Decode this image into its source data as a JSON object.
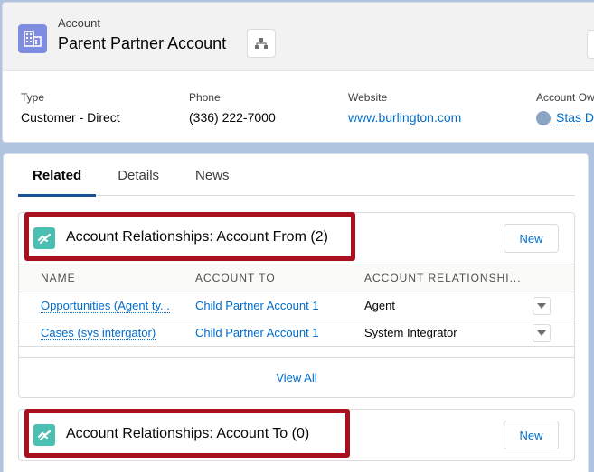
{
  "header": {
    "object_label": "Account",
    "record_title": "Parent Partner Account",
    "icons": {
      "object": "account-building-icon",
      "hierarchy": "hierarchy-icon"
    },
    "fields": [
      {
        "label": "Type",
        "value": "Customer - Direct"
      },
      {
        "label": "Phone",
        "value": "(336) 222-7000"
      },
      {
        "label": "Website",
        "value": "www.burlington.com"
      },
      {
        "label": "Account Ow",
        "value": "Stas D"
      }
    ]
  },
  "tabs": [
    {
      "label": "Related",
      "active": true
    },
    {
      "label": "Details",
      "active": false
    },
    {
      "label": "News",
      "active": false
    }
  ],
  "related_lists": [
    {
      "title": "Account Relationships: Account From (2)",
      "new_label": "New",
      "columns": [
        "NAME",
        "ACCOUNT TO",
        "ACCOUNT RELATIONSHI..."
      ],
      "rows": [
        {
          "name": "Opportunities (Agent ty...",
          "account_to": "Child Partner Account 1",
          "relationship": "Agent"
        },
        {
          "name": "Cases (sys intergator)",
          "account_to": "Child Partner Account 1",
          "relationship": "System Integrator"
        }
      ],
      "view_all": "View All"
    },
    {
      "title": "Account Relationships: Account To (0)",
      "new_label": "New"
    }
  ],
  "colors": {
    "highlight": "#a8101f",
    "link": "#006dcc",
    "account_icon": "#7f8de1",
    "relationship_icon": "#4bc0b2"
  }
}
